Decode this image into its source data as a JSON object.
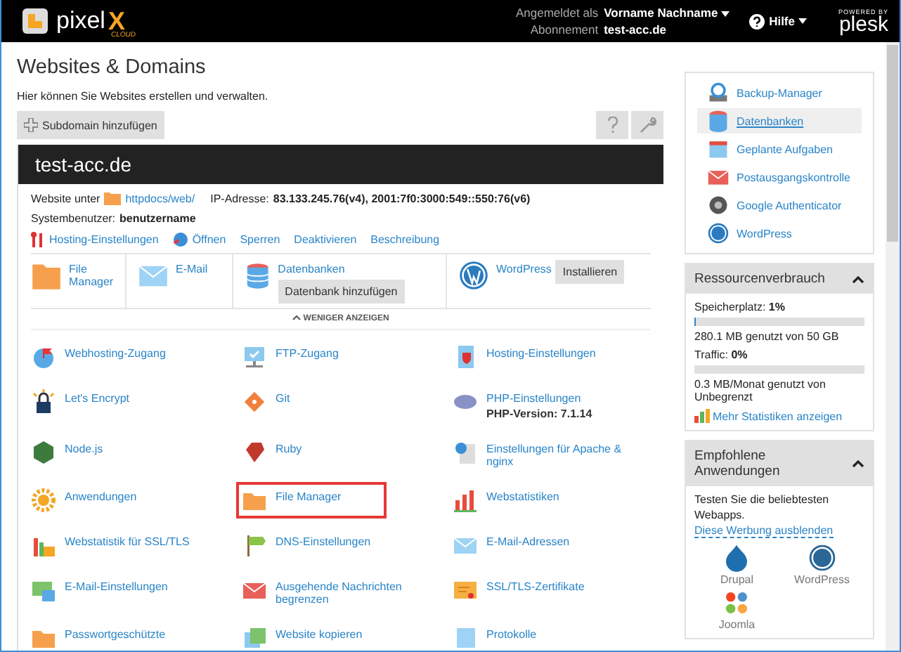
{
  "header": {
    "logo_text": "pixel",
    "logo_accent": "X",
    "logo_sub": "CLOUD",
    "login_label": "Angemeldet als",
    "user": "Vorname Nachname",
    "subscription_label": "Abonnement",
    "subscription": "test-acc.de",
    "help": "Hilfe",
    "powered_by": "POWERED BY",
    "brand": "plesk"
  },
  "page": {
    "title": "Websites & Domains",
    "subtitle": "Hier können Sie Websites erstellen und verwalten.",
    "add_button": "Subdomain hinzufügen"
  },
  "domain": {
    "name": "test-acc.de",
    "website_label": "Website unter",
    "docroot": "httpdocs/web/",
    "ip_label": "IP-Adresse:",
    "ip": "83.133.245.76(v4), 2001:7f0:3000:549::550:76(v6)",
    "sysuser_label": "Systembenutzer:",
    "sysuser": "benutzername",
    "actions": [
      "Hosting-Einstellungen",
      "Öffnen",
      "Sperren",
      "Deaktivieren",
      "Beschreibung"
    ],
    "quick": [
      {
        "label": "File Manager"
      },
      {
        "label": "E-Mail"
      },
      {
        "label": "Datenbanken",
        "button": "Datenbank hinzufügen"
      },
      {
        "label": "WordPress",
        "button": "Installieren"
      }
    ],
    "less_link": "WENIGER ANZEIGEN",
    "tools": [
      {
        "label": "Webhosting-Zugang",
        "highlighted": false
      },
      {
        "label": "FTP-Zugang",
        "highlighted": false
      },
      {
        "label": "Hosting-Einstellungen",
        "highlighted": false
      },
      {
        "label": "Let's Encrypt",
        "highlighted": false
      },
      {
        "label": "Git",
        "highlighted": false
      },
      {
        "label": "PHP-Einstellungen",
        "note": "PHP-Version: 7.1.14",
        "highlighted": false
      },
      {
        "label": "Node.js",
        "highlighted": false
      },
      {
        "label": "Ruby",
        "highlighted": false
      },
      {
        "label": "Einstellungen für Apache & nginx",
        "highlighted": false
      },
      {
        "label": "Anwendungen",
        "highlighted": false
      },
      {
        "label": "File Manager",
        "highlighted": true
      },
      {
        "label": "Webstatistiken",
        "highlighted": false
      },
      {
        "label": "Webstatistik für SSL/TLS",
        "highlighted": false
      },
      {
        "label": "DNS-Einstellungen",
        "highlighted": false
      },
      {
        "label": "E-Mail-Adressen",
        "highlighted": false
      },
      {
        "label": "E-Mail-Einstellungen",
        "highlighted": false
      },
      {
        "label": "Ausgehende Nachrichten begrenzen",
        "highlighted": false
      },
      {
        "label": "SSL/TLS-Zertifikate",
        "highlighted": false
      },
      {
        "label": "Passwortgeschützte",
        "highlighted": false
      },
      {
        "label": "Website kopieren",
        "highlighted": false
      },
      {
        "label": "Protokolle",
        "highlighted": false
      }
    ]
  },
  "sidebar": {
    "items": [
      {
        "label": "Backup-Manager",
        "selected": false
      },
      {
        "label": "Datenbanken",
        "selected": true
      },
      {
        "label": "Geplante Aufgaben",
        "selected": false
      },
      {
        "label": "Postausgangskontrolle",
        "selected": false
      },
      {
        "label": "Google Authenticator",
        "selected": false
      },
      {
        "label": "WordPress",
        "selected": false
      }
    ],
    "resources": {
      "title": "Ressourcenverbrauch",
      "meters": [
        {
          "label": "Speicherplatz:",
          "value": "1%",
          "level": 0.01,
          "usage": "280.1 MB genutzt von 50 GB"
        },
        {
          "label": "Traffic:",
          "value": "0%",
          "level": 0,
          "usage": "0.3 MB/Monat genutzt von Unbegrenzt"
        }
      ],
      "more_link": "Mehr Statistiken anzeigen"
    },
    "apps": {
      "title": "Empfohlene Anwendungen",
      "text": "Testen Sie die beliebtesten Webapps.",
      "hide_link": "Diese Werbung ausblenden",
      "apps": [
        "Drupal",
        "WordPress",
        "Joomla"
      ]
    }
  }
}
